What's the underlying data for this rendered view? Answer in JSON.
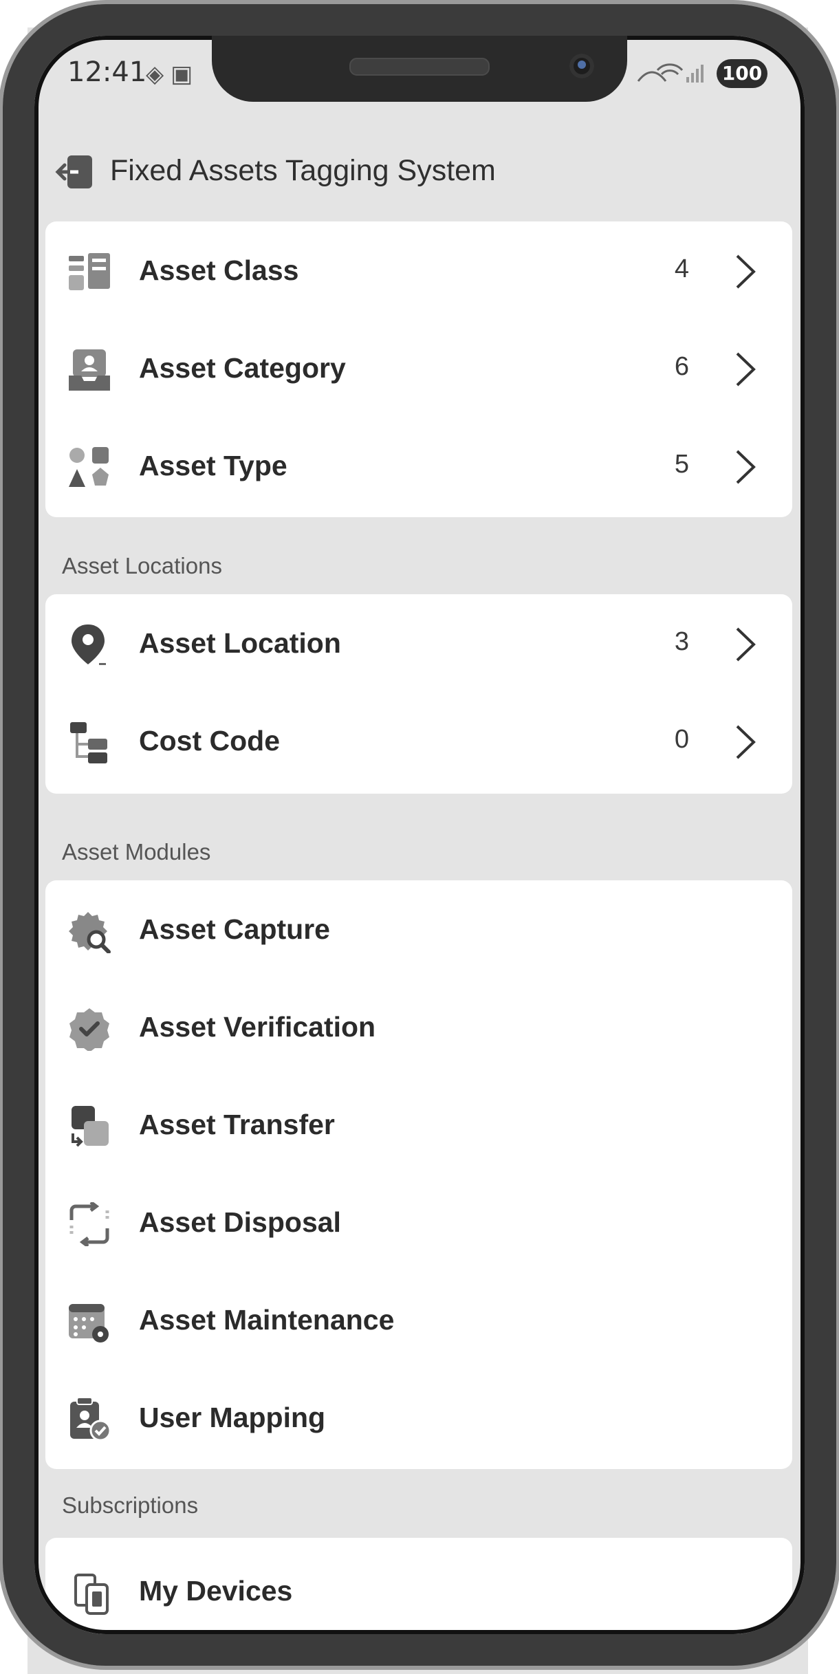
{
  "status_bar": {
    "time": "12:41",
    "battery": "100",
    "left_icons": [
      "settings-diamond-icon",
      "screenshot-icon"
    ],
    "right_icons": [
      "mute-icon",
      "wifi-icon",
      "signal-icon"
    ]
  },
  "header": {
    "back_icon": "exit-icon",
    "title": "Fixed Assets Tagging System"
  },
  "asset_setup": {
    "items": [
      {
        "label": "Asset Class",
        "count": "4",
        "icon": "list-grid-icon"
      },
      {
        "label": "Asset Category",
        "count": "6",
        "icon": "inbox-user-icon"
      },
      {
        "label": "Asset Type",
        "count": "5",
        "icon": "shapes-icon"
      }
    ]
  },
  "asset_locations": {
    "heading": "Asset Locations",
    "items": [
      {
        "label": "Asset Location",
        "count": "3",
        "icon": "map-pin-icon"
      },
      {
        "label": "Cost Code",
        "count": "0",
        "icon": "tree-structure-icon"
      }
    ]
  },
  "asset_modules": {
    "heading": "Asset Modules",
    "items": [
      {
        "label": "Asset Capture",
        "icon": "gear-search-icon"
      },
      {
        "label": "Asset Verification",
        "icon": "verified-badge-icon"
      },
      {
        "label": "Asset Transfer",
        "icon": "transfer-icon"
      },
      {
        "label": "Asset Disposal",
        "icon": "recycle-arrows-icon"
      },
      {
        "label": "Asset Maintenance",
        "icon": "calendar-gear-icon"
      },
      {
        "label": "User Mapping",
        "icon": "clipboard-user-check-icon"
      }
    ]
  },
  "subscriptions": {
    "heading": "Subscriptions",
    "items": [
      {
        "label": "My Devices",
        "icon": "devices-icon"
      }
    ]
  },
  "colors": {
    "background": "#e4e4e4",
    "card": "#ffffff",
    "icon": "#6e6e6e",
    "text": "#2b2b2b"
  }
}
